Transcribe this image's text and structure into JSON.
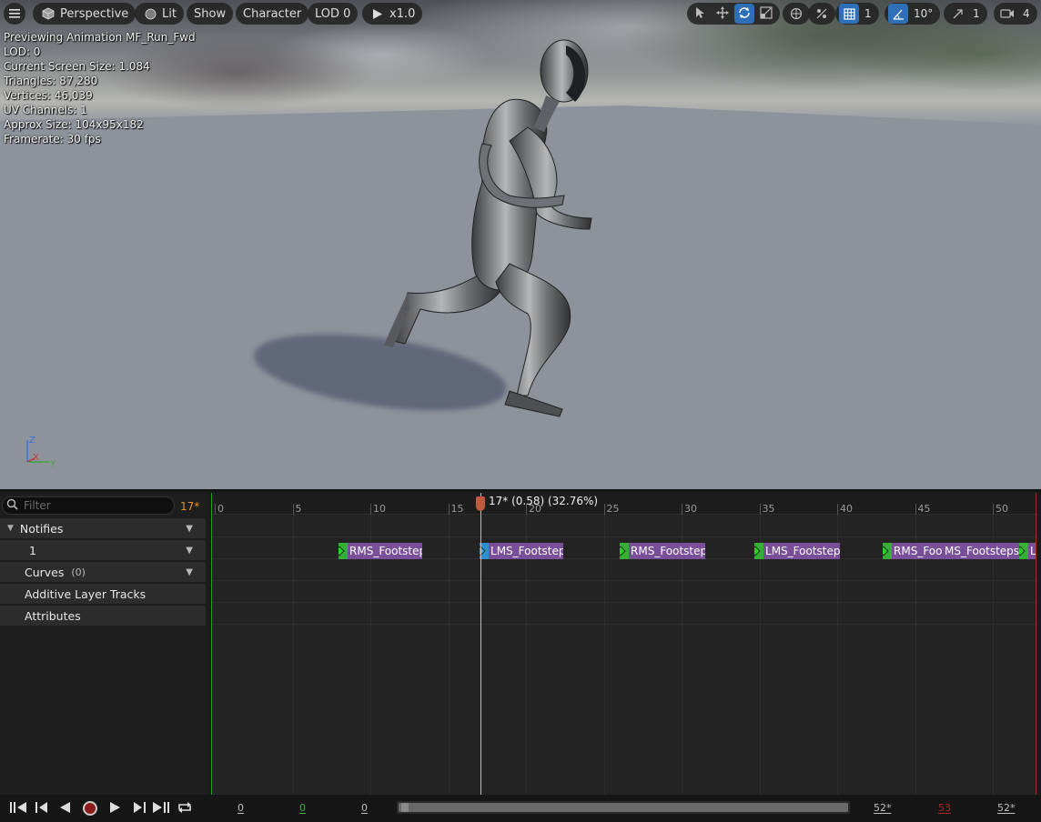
{
  "toolbar": {
    "menu_icon": "hamburger-icon",
    "perspective": "Perspective",
    "lit": "Lit",
    "show": "Show",
    "character": "Character",
    "lod": "LOD 0",
    "play_speed": "x1.0",
    "grid_size": "1",
    "angle_snap": "10°",
    "scale_snap": "1",
    "camera_speed": "4"
  },
  "stats": {
    "line1": "Previewing Animation MF_Run_Fwd",
    "line2": "LOD: 0",
    "line3": "Current Screen Size: 1.084",
    "line4": "Triangles: 87,280",
    "line5": "Vertices: 46,039",
    "line6": "UV Channels: 1",
    "line7": "Approx Size: 104x95x182",
    "line8": "Framerate: 30 fps"
  },
  "axis": {
    "z": "Z",
    "x": "X",
    "y": "Y"
  },
  "tracks": {
    "filter_placeholder": "Filter",
    "frame_indicator": "17*",
    "notifies": "Notifies",
    "notify_track": "1",
    "curves": "Curves",
    "curves_count": "(0)",
    "additive": "Additive Layer Tracks",
    "attributes": "Attributes"
  },
  "ruler": {
    "labels": [
      "0",
      "5",
      "10",
      "15",
      "20",
      "25",
      "30",
      "35",
      "40",
      "45",
      "50"
    ],
    "scrub_label": "17* (0.58) (32.76%)"
  },
  "notifies": [
    {
      "prefix": "R",
      "name": "MS_Footsteps"
    },
    {
      "prefix": "L",
      "name": "MS_Footsteps"
    },
    {
      "prefix": "R",
      "name": "MS_Footsteps"
    },
    {
      "prefix": "L",
      "name": "MS_Footsteps"
    },
    {
      "prefix": "R",
      "name": "MS_Footsteps"
    },
    {
      "prefix": "",
      "name": "MS_Footsteps"
    },
    {
      "prefix": "L",
      "name": ""
    }
  ],
  "transport": {
    "start_a": "0",
    "start_b": "0",
    "start_c": "0",
    "end_a": "52*",
    "end_b": "53",
    "end_c": "52*"
  },
  "colors": {
    "accent_blue": "#2f6fb8",
    "notify_purple": "#7a4f9a",
    "notify_green": "#35b035",
    "scrub_red": "#c05a3e",
    "frame_orange": "#e5902a"
  }
}
